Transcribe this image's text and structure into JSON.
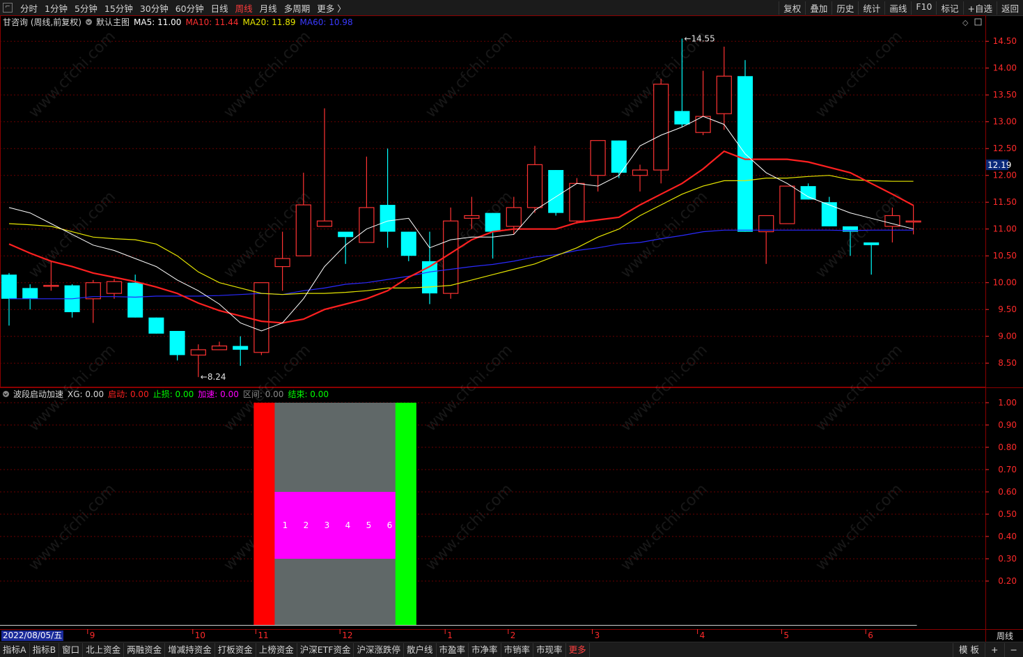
{
  "toolbar": {
    "periods": [
      "分时",
      "1分钟",
      "5分钟",
      "15分钟",
      "30分钟",
      "60分钟",
      "日线",
      "周线",
      "月线",
      "多周期",
      "更多 〉"
    ],
    "active_period": "周线",
    "actions": [
      "复权",
      "叠加",
      "历史",
      "统计",
      "画线",
      "F10",
      "标记",
      "+自选",
      "返回"
    ]
  },
  "main_legend": {
    "title": "甘咨询 (周线,前复权)",
    "template": "默认主图",
    "ma5": "MA5: 11.00",
    "ma10": "MA10: 11.44",
    "ma20": "MA20: 11.89",
    "ma60": "MA60: 10.98"
  },
  "sub_legend": {
    "title": "波段启动加速",
    "xg": "XG: 0.00",
    "qidong": "启动: 0.00",
    "zhisun": "止损: 0.00",
    "jiasu": "加速: 0.00",
    "qujian": "区间: 0.00",
    "jieshu": "结束: 0.00"
  },
  "colors": {
    "up": "#ff3333",
    "down": "#00ffff",
    "ma5": "#ffffff",
    "ma10": "#ff2020",
    "ma20": "#e6e600",
    "ma60": "#2a2aff",
    "start": "#ff0000",
    "end": "#00ff00",
    "zone": "#606868",
    "accel": "#ff00ff",
    "axis": "#ff2a2a"
  },
  "current_price_label": "12.19",
  "watermark": "www.cfchi.com",
  "date_cursor": "2022/08/05/五",
  "period_label": "周线",
  "bottom_tabs": [
    "指标A",
    "指标B",
    "窗口",
    "北上资金",
    "两融资金",
    "增减持资金",
    "打板资金",
    "上榜资金",
    "沪深ETF资金",
    "沪深涨跌停",
    "散户线",
    "市盈率",
    "市净率",
    "市销率",
    "市现率",
    "更多"
  ],
  "bottom_right": [
    "模 板",
    "+",
    "−"
  ],
  "chart_data": {
    "type": "candlestick",
    "price_axis": {
      "ticks": [
        "14.50",
        "14.00",
        "13.50",
        "13.00",
        "12.50",
        "12.00",
        "11.50",
        "11.00",
        "10.50",
        "10.00",
        "9.50",
        "9.00",
        "8.50"
      ],
      "ylim": [
        8.1,
        14.75
      ]
    },
    "sub_axis": {
      "ticks": [
        "1.00",
        "0.90",
        "0.80",
        "0.70",
        "0.60",
        "0.50",
        "0.40",
        "0.30",
        "0.20"
      ],
      "ylim": [
        0,
        1
      ]
    },
    "x_labels": [
      "9",
      "10",
      "11",
      "12",
      "1",
      "2",
      "3",
      "4",
      "5",
      "6"
    ],
    "x_label_index": [
      4,
      9,
      12,
      16,
      21,
      24,
      28,
      33,
      37,
      41
    ],
    "annotations": [
      {
        "text": "14.55",
        "index": 32,
        "price": 14.55
      },
      {
        "text": "8.24",
        "index": 9,
        "price": 8.24
      }
    ],
    "ohlc": [
      [
        10.15,
        10.18,
        9.2,
        9.7
      ],
      [
        9.9,
        9.97,
        9.5,
        9.7
      ],
      [
        9.95,
        10.4,
        9.85,
        9.95
      ],
      [
        9.95,
        9.97,
        9.35,
        9.45
      ],
      [
        9.7,
        10.05,
        9.25,
        10.0
      ],
      [
        9.8,
        10.07,
        9.7,
        10.02
      ],
      [
        10.0,
        10.15,
        9.35,
        9.35
      ],
      [
        9.35,
        9.35,
        9.05,
        9.05
      ],
      [
        9.1,
        9.1,
        8.55,
        8.65
      ],
      [
        8.65,
        8.85,
        8.24,
        8.75
      ],
      [
        8.75,
        8.9,
        8.75,
        8.82
      ],
      [
        8.82,
        9.0,
        8.45,
        8.75
      ],
      [
        8.7,
        10.0,
        8.65,
        10.0
      ],
      [
        10.3,
        10.95,
        9.85,
        10.45
      ],
      [
        10.5,
        12.05,
        10.5,
        11.45
      ],
      [
        11.05,
        13.25,
        11.05,
        11.15
      ],
      [
        10.95,
        10.85,
        10.35,
        10.85
      ],
      [
        10.75,
        12.35,
        10.75,
        11.4
      ],
      [
        11.45,
        12.5,
        10.65,
        10.95
      ],
      [
        10.95,
        10.95,
        10.4,
        10.5
      ],
      [
        10.4,
        10.95,
        9.6,
        9.8
      ],
      [
        9.8,
        11.4,
        9.7,
        11.15
      ],
      [
        11.2,
        11.6,
        11.0,
        11.25
      ],
      [
        11.3,
        11.3,
        10.45,
        10.95
      ],
      [
        11.05,
        11.6,
        10.9,
        11.4
      ],
      [
        11.4,
        12.55,
        11.3,
        12.2
      ],
      [
        12.1,
        12.1,
        11.25,
        11.3
      ],
      [
        11.15,
        11.95,
        11.1,
        11.85
      ],
      [
        12.0,
        12.6,
        11.7,
        12.65
      ],
      [
        12.65,
        12.65,
        11.95,
        12.05
      ],
      [
        12.0,
        12.2,
        11.7,
        12.1
      ],
      [
        12.1,
        13.8,
        11.85,
        13.7
      ],
      [
        13.2,
        14.55,
        12.9,
        12.95
      ],
      [
        12.8,
        13.95,
        12.75,
        13.1
      ],
      [
        13.15,
        14.4,
        12.85,
        13.85
      ],
      [
        13.85,
        14.15,
        10.95,
        10.95
      ],
      [
        10.95,
        11.25,
        10.35,
        11.25
      ],
      [
        11.1,
        11.8,
        11.1,
        11.8
      ],
      [
        11.8,
        11.85,
        11.55,
        11.55
      ],
      [
        11.5,
        11.6,
        11.05,
        11.05
      ],
      [
        11.05,
        11.05,
        10.5,
        10.95
      ],
      [
        10.75,
        10.75,
        10.15,
        10.7
      ],
      [
        11.05,
        11.4,
        10.75,
        11.25
      ],
      [
        11.15,
        11.45,
        10.9,
        11.15
      ]
    ],
    "ma5": [
      11.4,
      11.3,
      11.1,
      10.9,
      10.7,
      10.6,
      10.45,
      10.3,
      10.05,
      9.85,
      9.6,
      9.25,
      9.1,
      9.25,
      9.7,
      10.3,
      10.7,
      11.0,
      11.15,
      11.2,
      10.65,
      10.8,
      10.85,
      10.85,
      10.9,
      11.35,
      11.6,
      11.85,
      11.8,
      12.0,
      12.55,
      12.75,
      12.9,
      13.1,
      12.95,
      12.4,
      12.05,
      11.85,
      11.6,
      11.45,
      11.3,
      11.2,
      11.1,
      11.0
    ],
    "ma10": [
      10.72,
      10.55,
      10.4,
      10.3,
      10.18,
      10.1,
      10.02,
      9.92,
      9.8,
      9.62,
      9.48,
      9.38,
      9.28,
      9.25,
      9.32,
      9.5,
      9.6,
      9.7,
      9.85,
      10.1,
      10.3,
      10.55,
      10.8,
      10.95,
      11.0,
      11.0,
      11.0,
      11.12,
      11.17,
      11.22,
      11.45,
      11.65,
      11.85,
      12.12,
      12.45,
      12.3,
      12.3,
      12.3,
      12.25,
      12.15,
      12.05,
      11.85,
      11.65,
      11.44
    ],
    "ma20": [
      11.1,
      11.08,
      11.05,
      10.95,
      10.85,
      10.82,
      10.8,
      10.72,
      10.5,
      10.2,
      10.0,
      9.9,
      9.8,
      9.78,
      9.8,
      9.8,
      9.82,
      9.85,
      9.9,
      9.9,
      9.92,
      9.95,
      10.05,
      10.15,
      10.25,
      10.35,
      10.5,
      10.65,
      10.85,
      11.0,
      11.25,
      11.45,
      11.65,
      11.8,
      11.9,
      11.9,
      11.95,
      11.95,
      11.98,
      12.0,
      11.92,
      11.9,
      11.89,
      11.89
    ],
    "ma60": [
      9.7,
      9.7,
      9.7,
      9.7,
      9.74,
      9.74,
      9.73,
      9.75,
      9.75,
      9.75,
      9.76,
      9.78,
      9.8,
      9.78,
      9.85,
      9.9,
      9.97,
      10.0,
      10.06,
      10.12,
      10.2,
      10.25,
      10.3,
      10.34,
      10.4,
      10.48,
      10.52,
      10.6,
      10.65,
      10.72,
      10.75,
      10.82,
      10.88,
      10.95,
      10.98,
      10.98,
      10.98,
      10.98,
      10.98,
      10.98,
      10.97,
      10.98,
      10.98,
      10.98
    ],
    "signal": {
      "start_index": 12,
      "end_index": 19,
      "accel_labels": [
        "1",
        "2",
        "3",
        "4",
        "5",
        "6"
      ],
      "accel_level": [
        0.3,
        0.6
      ]
    }
  }
}
